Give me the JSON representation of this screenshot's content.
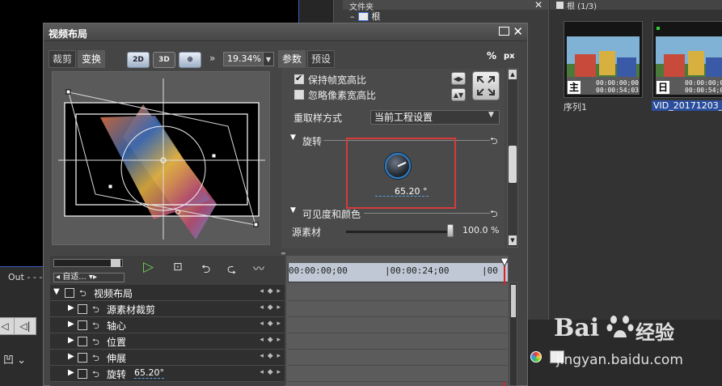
{
  "background": {
    "player_out_label": "Out",
    "player_dashes": "- - -",
    "folder_panel": {
      "title": "文件夹",
      "tree_root": "根"
    },
    "bin_panel": {
      "title": "根 (1/3)",
      "clips": [
        {
          "name": "序列1",
          "badge": "主",
          "tc1": "00:00:00;00",
          "tc2": "00:00:54;03"
        },
        {
          "name": "VID_20171203_1...",
          "badge": "日",
          "tc1": "00:00:00;00",
          "tc2": "00:00:54;03"
        }
      ]
    },
    "watermark": {
      "brand": "Bai",
      "brand_du": "经验",
      "url": "jingyan.baidu.com"
    }
  },
  "dialog": {
    "title": "视频布局",
    "left_tabs": [
      "裁剪",
      "变换"
    ],
    "mode_buttons": [
      "2D",
      "3D",
      "⊕"
    ],
    "zoom": "19.34%",
    "right_tabs": [
      "参数",
      "预设"
    ],
    "units": {
      "percent": "%",
      "px": "px"
    },
    "params": {
      "keep_aspect": {
        "label": "保持帧宽高比",
        "checked": true
      },
      "ignore_pixel_aspect": {
        "label": "忽略像素宽高比",
        "checked": false
      },
      "resample_label": "重取样方式",
      "resample_value": "当前工程设置",
      "rotation_section": "旋转",
      "rotation_value": "65.20 °",
      "visibility_section": "可见度和颜色",
      "source_label": "源素材",
      "source_value": "100.0 %"
    },
    "timeline": {
      "auto_label": "自适...",
      "ruler_ticks": [
        "00:00:00;00",
        "|00:00:24;00",
        "|00"
      ],
      "tracks": [
        {
          "name": "视频布局",
          "level": 0
        },
        {
          "name": "源素材裁剪",
          "level": 1
        },
        {
          "name": "轴心",
          "level": 1
        },
        {
          "name": "位置",
          "level": 1
        },
        {
          "name": "伸展",
          "level": 1
        },
        {
          "name": "旋转",
          "level": 1,
          "value": "65.20°"
        }
      ]
    }
  },
  "colors": {
    "highlight_box": "#d83a3a",
    "knob_ring": "#2f7fc5",
    "play_green": "#6ad04a"
  }
}
